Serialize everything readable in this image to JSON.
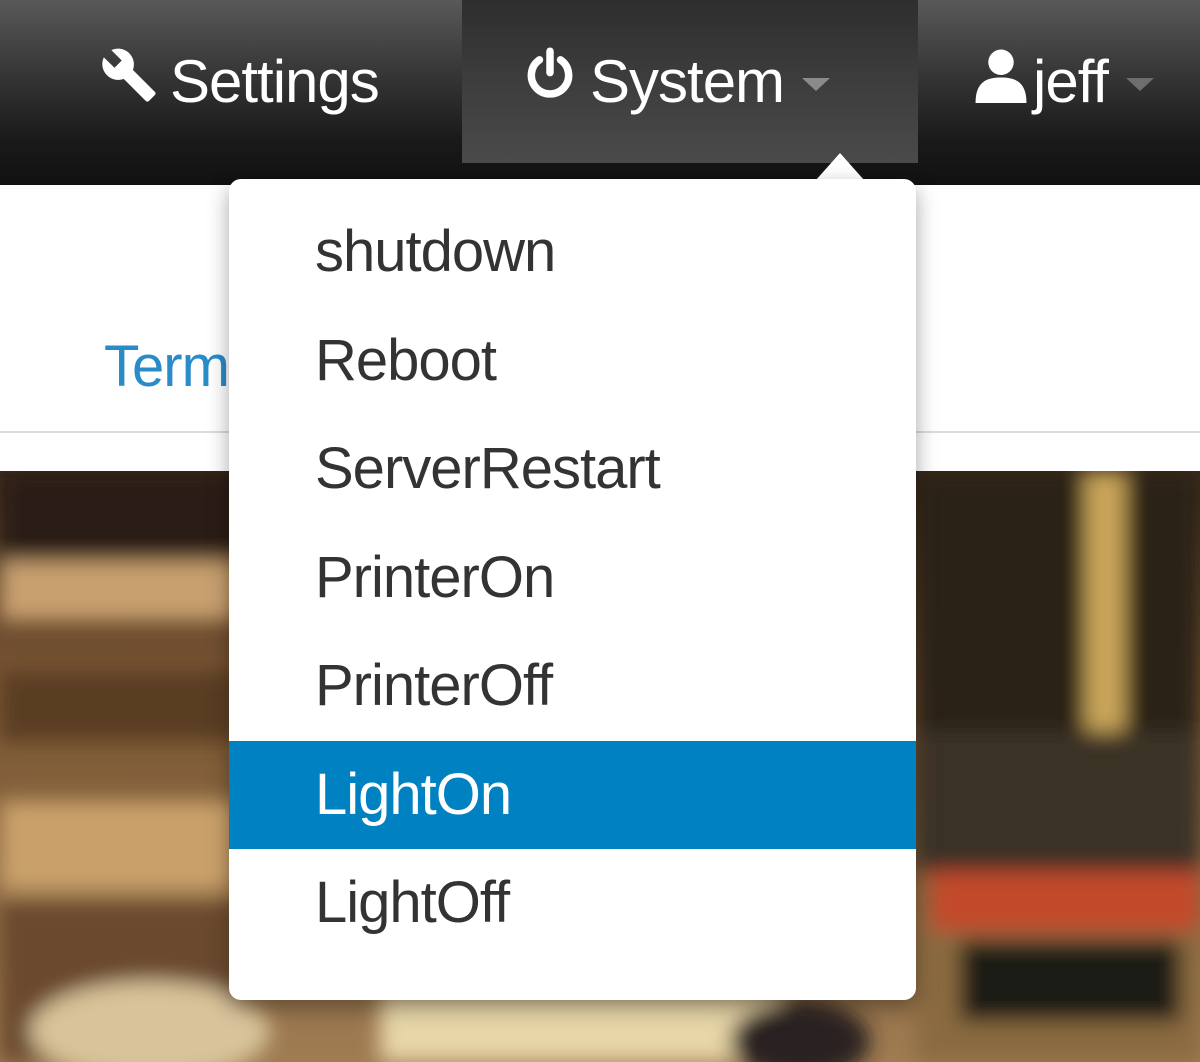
{
  "navbar": {
    "settings": {
      "label": "Settings",
      "icon": "wrench-icon"
    },
    "system": {
      "label": "System",
      "icon": "power-icon"
    },
    "user": {
      "label": "jeff",
      "icon": "user-icon"
    }
  },
  "tabs": {
    "terminal_label": "Term"
  },
  "system_menu": {
    "items": [
      {
        "label": "shutdown"
      },
      {
        "label": "Reboot"
      },
      {
        "label": "ServerRestart"
      },
      {
        "label": "PrinterOn"
      },
      {
        "label": "PrinterOff"
      },
      {
        "label": "LightOn",
        "highlighted": true
      },
      {
        "label": "LightOff"
      }
    ]
  },
  "colors": {
    "menu_highlight": "#0081c2",
    "link_blue": "#2a8bc9",
    "navbar_dark": "#1a1a1a"
  }
}
